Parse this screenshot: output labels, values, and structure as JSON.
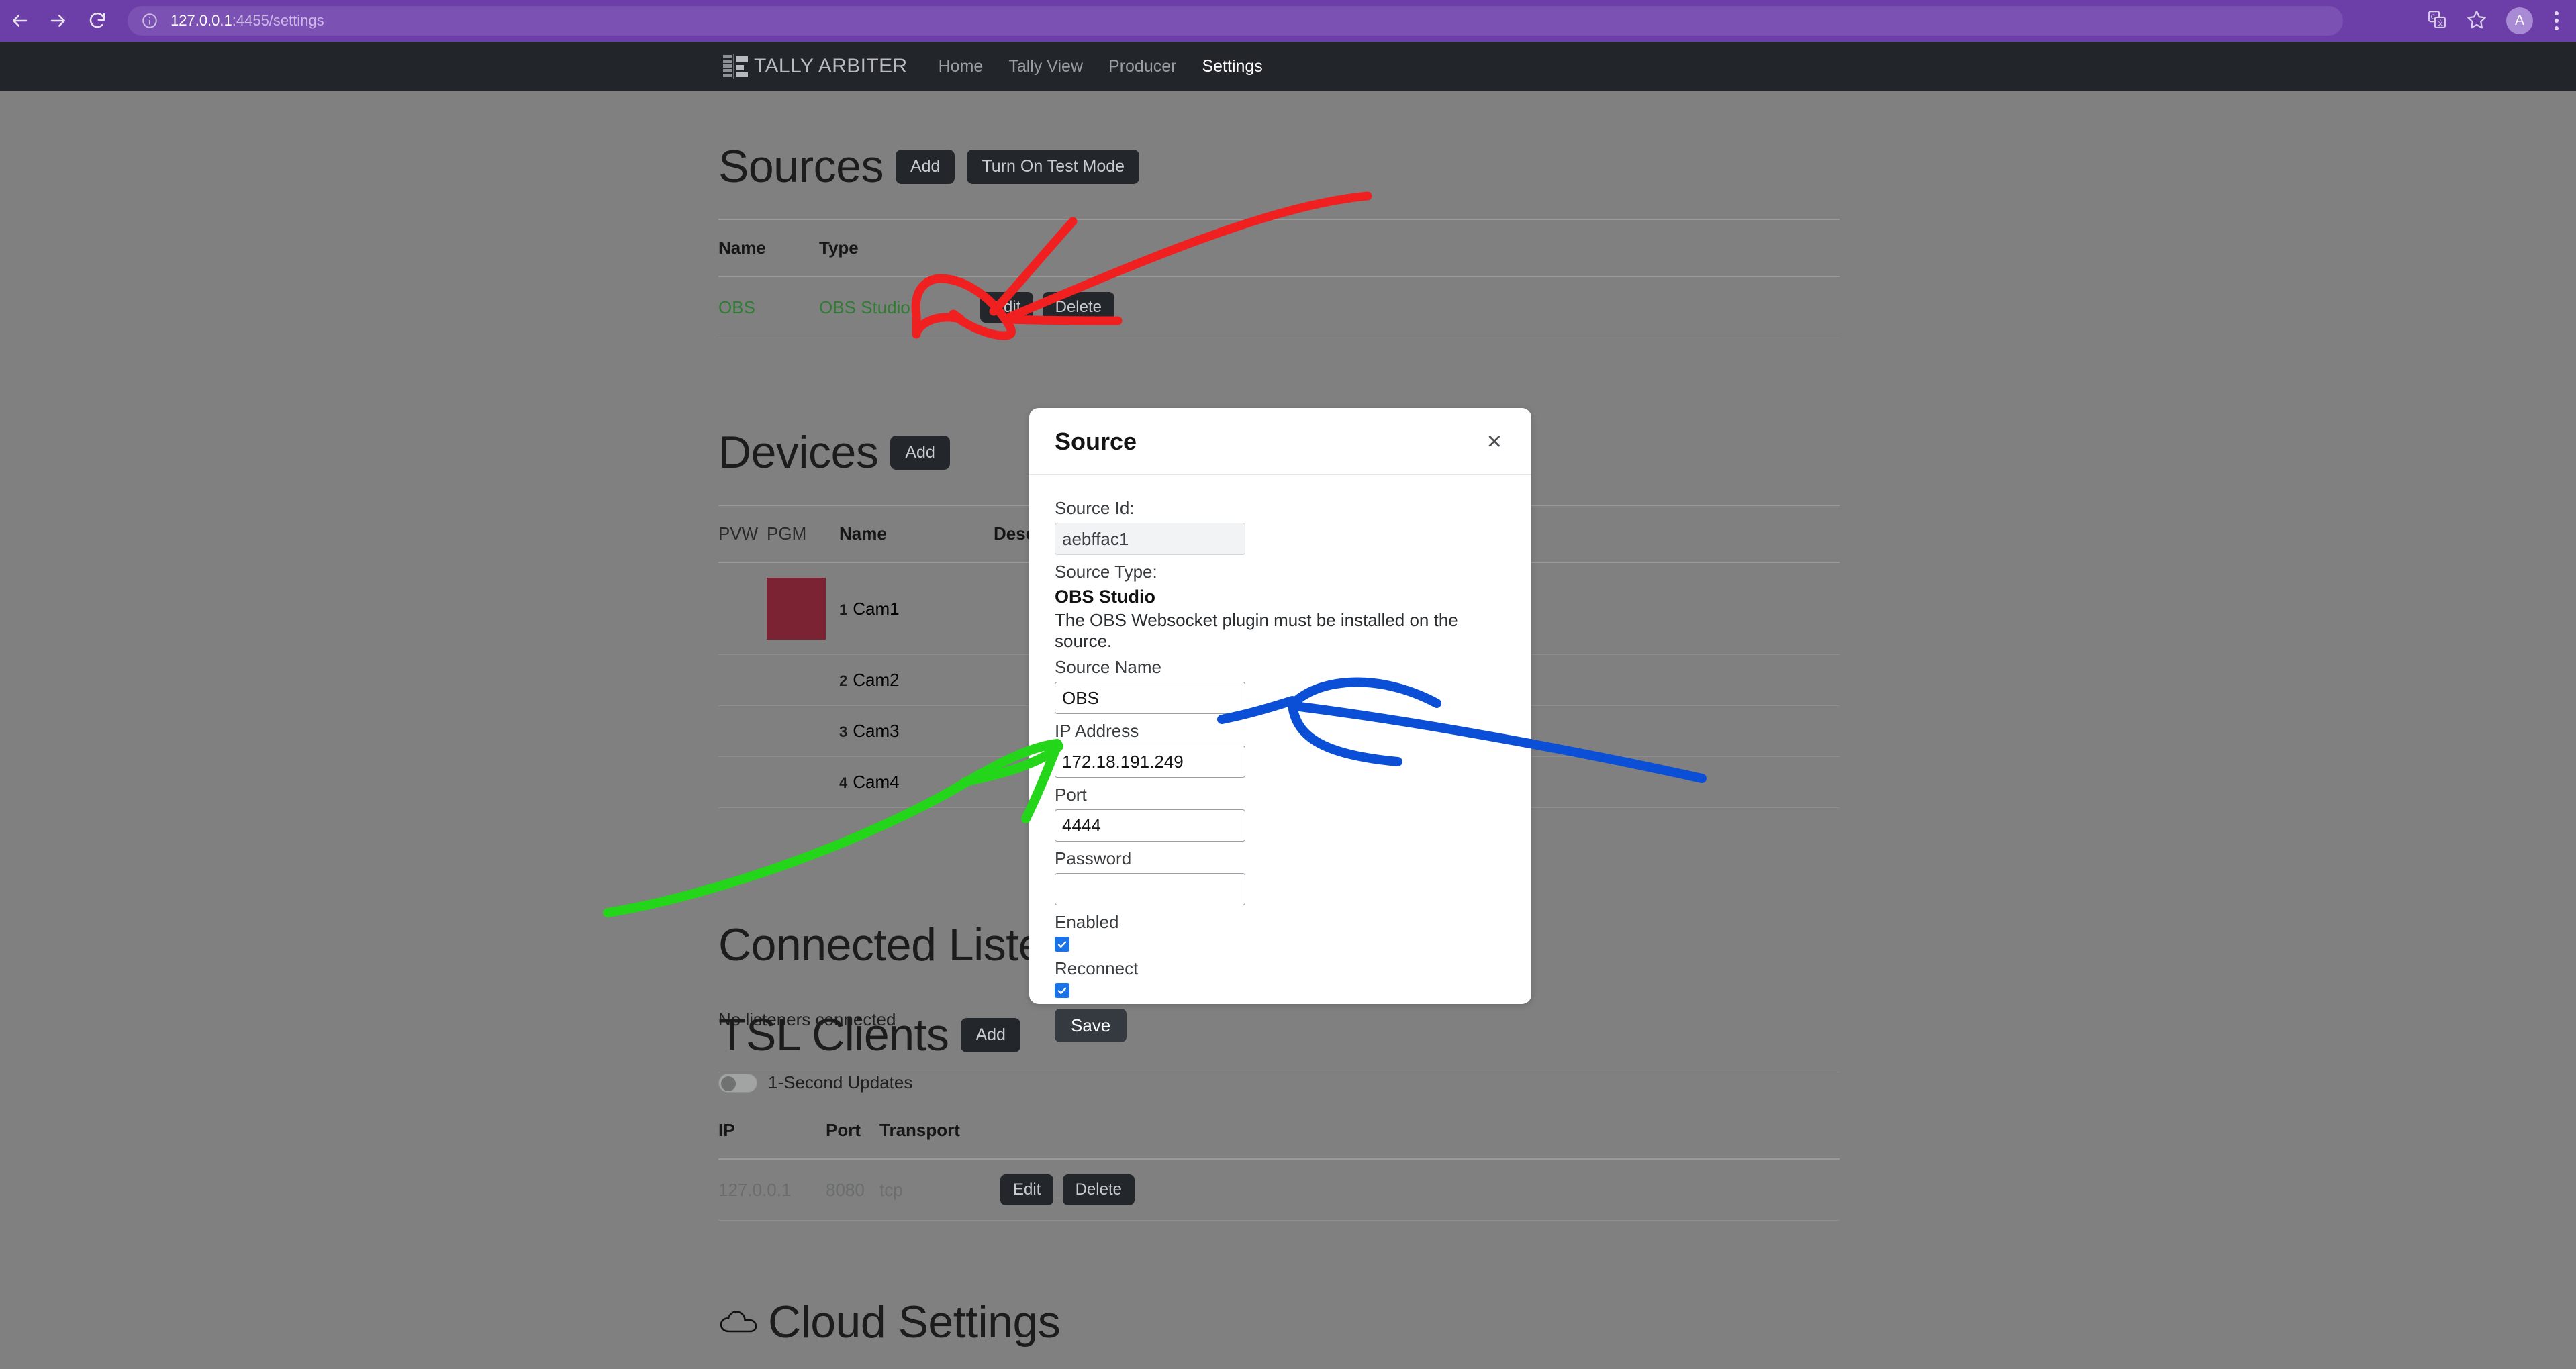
{
  "browser": {
    "url_host": "127.0.0.1",
    "url_rest": ":4455/settings",
    "back_icon": "back-arrow-icon",
    "forward_icon": "forward-arrow-icon",
    "reload_icon": "reload-icon",
    "info_icon": "site-info-icon",
    "translate_icon": "translate-icon",
    "bookmark_icon": "star-icon",
    "profile_initial": "A",
    "menu_icon": "kebab-menu-icon",
    "toolbar_color": "#6c3fa8"
  },
  "navbar": {
    "brand": "TALLY ARBITER",
    "links": [
      {
        "label": "Home",
        "active": false
      },
      {
        "label": "Tally View",
        "active": false
      },
      {
        "label": "Producer",
        "active": false
      },
      {
        "label": "Settings",
        "active": true
      }
    ]
  },
  "sources": {
    "title": "Sources",
    "add_label": "Add",
    "test_mode_label": "Turn On Test Mode",
    "columns": [
      "Name",
      "Type"
    ],
    "rows": [
      {
        "name": "OBS",
        "type": "OBS Studio",
        "edit_label": "Edit",
        "delete_label": "Delete"
      }
    ]
  },
  "devices": {
    "title": "Devices",
    "add_label": "Add",
    "columns": [
      "PVW",
      "PGM",
      "Name",
      "Description"
    ],
    "rows": [
      {
        "index": "1",
        "name": "Cam1",
        "pgm_active": true,
        "pgm_color": "#7b2233",
        "description": ""
      },
      {
        "index": "2",
        "name": "Cam2",
        "pgm_active": false,
        "pgm_color": "",
        "description": ""
      },
      {
        "index": "3",
        "name": "Cam3",
        "pgm_active": false,
        "pgm_color": "",
        "description": ""
      },
      {
        "index": "4",
        "name": "Cam4",
        "pgm_active": false,
        "pgm_color": "",
        "description": ""
      }
    ]
  },
  "listeners": {
    "title": "Connected Listeners",
    "empty_text": "No listeners connected"
  },
  "tsl_clients": {
    "title": "TSL Clients",
    "add_label": "Add",
    "toggle_label": "1-Second Updates",
    "toggle_on": false,
    "columns": [
      "IP",
      "Port",
      "Transport"
    ],
    "rows": [
      {
        "ip": "127.0.0.1",
        "port": "8080",
        "transport": "tcp",
        "edit_label": "Edit",
        "delete_label": "Delete"
      }
    ]
  },
  "cloud": {
    "title": "Cloud Settings",
    "icon": "cloud-icon"
  },
  "modal": {
    "title": "Source",
    "close_icon": "close-icon",
    "source_id_label": "Source Id:",
    "source_id_value": "aebffac1",
    "source_type_label": "Source Type:",
    "source_type_value": "OBS Studio",
    "help_text": "The OBS Websocket plugin must be installed on the source.",
    "source_name_label": "Source Name",
    "source_name_value": "OBS",
    "ip_label": "IP Address",
    "ip_value": "172.18.191.249",
    "port_label": "Port",
    "port_value": "4444",
    "password_label": "Password",
    "password_value": "",
    "enabled_label": "Enabled",
    "enabled_checked": true,
    "reconnect_label": "Reconnect",
    "reconnect_checked": true,
    "save_label": "Save"
  },
  "annotations": {
    "red_color": "#f02020",
    "blue_color": "#0b4fd6",
    "green_color": "#23d619"
  }
}
